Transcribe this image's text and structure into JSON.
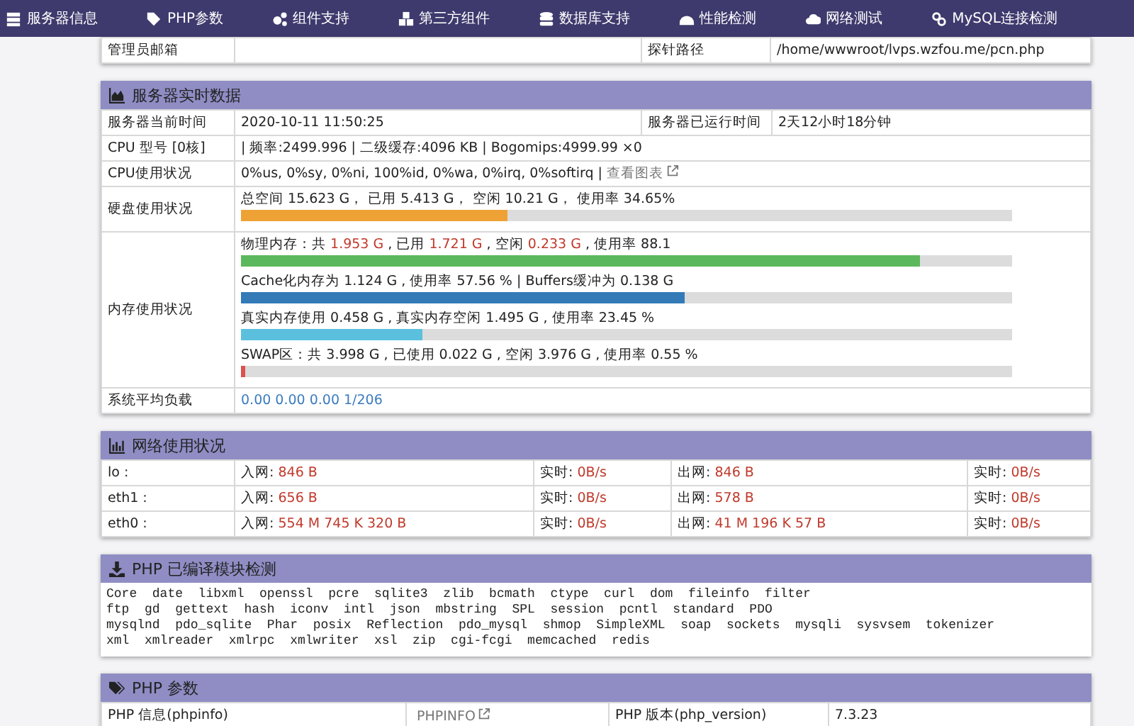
{
  "nav": [
    {
      "label": "服务器信息"
    },
    {
      "label": "PHP参数"
    },
    {
      "label": "组件支持"
    },
    {
      "label": "第三方组件"
    },
    {
      "label": "数据库支持"
    },
    {
      "label": "性能检测"
    },
    {
      "label": "网络测试"
    },
    {
      "label": "MySQL连接检测"
    }
  ],
  "top_row": {
    "label": "管理员邮箱",
    "label_2": "探针路径",
    "value_2": "/home/wwwroot/lvps.wzfou.me/pcn.php"
  },
  "realtime": {
    "title": "服务器实时数据",
    "time": {
      "label": "服务器当前时间",
      "value": "2020-10-11 11:50:25",
      "label_2": "服务器已运行时间",
      "value_2": "2天12小时18分钟"
    },
    "cpu_model": {
      "label": "CPU 型号 [0核]",
      "value": "| 频率:2499.996 | 二级缓存:4096 KB | Bogomips:4999.99 ×0"
    },
    "cpu_usage": {
      "label": "CPU使用状况",
      "value": "0%us, 0%sy, 0%ni, 100%id, 0%wa, 0%irq, 0%softirq |",
      "link": "查看图表"
    },
    "disk": {
      "label": "硬盘使用状况",
      "text": "总空间 15.623 G，  已用 5.413 G，  空闲 10.21 G，  使用率 34.65%",
      "level": 0.3465,
      "color": "#eea236"
    },
    "memory": {
      "label": "内存使用状况",
      "bars": [
        {
          "segments": [
            {
              "kind": "plain",
              "text": "物理内存：共 "
            },
            {
              "kind": "value",
              "text": "1.953 G"
            },
            {
              "kind": "plain",
              "text": " , 已用 "
            },
            {
              "kind": "value",
              "text": "1.721 G"
            },
            {
              "kind": "plain",
              "text": " , 空闲 "
            },
            {
              "kind": "value",
              "text": "0.233 G"
            },
            {
              "kind": "plain",
              "text": " , 使用率 88.1"
            }
          ],
          "level": 0.881,
          "color": "#5cb85c"
        },
        {
          "segments": [
            {
              "kind": "plain",
              "text": "Cache化内存为 1.124 G , 使用率 57.56 % | Buffers缓冲为 0.138 G"
            }
          ],
          "level": 0.5756,
          "color": "#337ab7"
        },
        {
          "segments": [
            {
              "kind": "plain",
              "text": "真实内存使用 0.458 G , 真实内存空闲 1.495 G , 使用率 23.45 %"
            }
          ],
          "level": 0.2345,
          "color": "#5bc0de"
        },
        {
          "segments": [
            {
              "kind": "plain",
              "text": "SWAP区：共 3.998 G , 已使用 0.022 G , 空闲 3.976 G , 使用率 0.55 %"
            }
          ],
          "level": 0.0055,
          "color": "#d9534f"
        }
      ]
    },
    "load": {
      "label": "系统平均负载",
      "value": "0.00 0.00 0.00 1/206"
    }
  },
  "network": {
    "title": "网络使用状况",
    "rows": [
      {
        "name": "lo :",
        "in_label": "入网:",
        "in": "846 B",
        "rt_label": "实时:",
        "rt_in": "0B/s",
        "out_label": "出网:",
        "out": "846 B",
        "rt_label_2": "实时:",
        "rt_out": "0B/s"
      },
      {
        "name": "eth1 :",
        "in_label": "入网:",
        "in": "656 B",
        "rt_label": "实时:",
        "rt_in": "0B/s",
        "out_label": "出网:",
        "out": "578 B",
        "rt_label_2": "实时:",
        "rt_out": "0B/s"
      },
      {
        "name": "eth0 :",
        "in_label": "入网:",
        "in": "554 M 745 K 320 B",
        "rt_label": "实时:",
        "rt_in": "0B/s",
        "out_label": "出网:",
        "out": "41 M 196 K 57 B",
        "rt_label_2": "实时:",
        "rt_out": "0B/s"
      }
    ]
  },
  "modules": {
    "title": "PHP 已编译模块检测",
    "lines": [
      "Core  date  libxml  openssl  pcre  sqlite3  zlib  bcmath  ctype  curl  dom  fileinfo  filter",
      "ftp  gd  gettext  hash  iconv  intl  json  mbstring  SPL  session  pcntl  standard  PDO",
      "mysqlnd  pdo_sqlite  Phar  posix  Reflection  pdo_mysql  shmop  SimpleXML  soap  sockets  mysqli  sysvsem  tokenizer",
      "xml  xmlreader  xmlrpc  xmlwriter  xsl  zip  cgi-fcgi  memcached  redis"
    ]
  },
  "php": {
    "title": "PHP 参数",
    "label": "PHP 信息(phpinfo)",
    "link": "PHPINFO",
    "label_2": "PHP 版本(php_version)",
    "value_2": "7.3.23"
  }
}
